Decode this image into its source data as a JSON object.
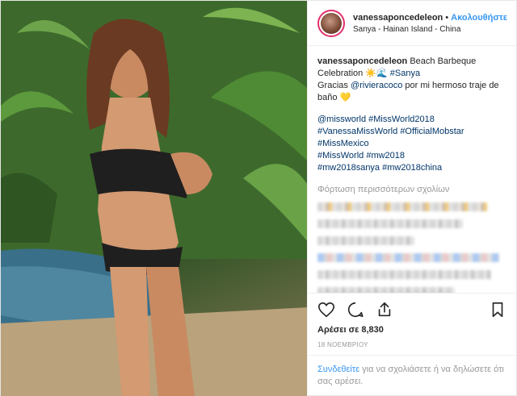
{
  "header": {
    "username": "vanessaponcedeleon",
    "separator": "•",
    "follow_label": "Ακολουθήστε",
    "location": "Sanya - Hainan Island - China"
  },
  "caption": {
    "username": "vanessaponcedeleon",
    "text": "Beach Barbeque Celebration ☀️🌊",
    "hashtag_sanya": "#Sanya",
    "line2_start": "Gracias",
    "mention": "@rivieracoco",
    "line2_end": "por mi hermoso traje de baño 💛"
  },
  "hashtags": {
    "line1": [
      "@missworld",
      "#MissWorld2018"
    ],
    "line2": [
      "#VanessaMissWorld",
      "#OfficialMobstar"
    ],
    "line3": [
      "#MissMexico"
    ],
    "line4": [
      "#MissWorld",
      "#mw2018"
    ],
    "line5": [
      "#mw2018sanya",
      "#mw2018china"
    ]
  },
  "load_more": "Φόρτωση περισσότερων σχολίων",
  "likes": "Αρέσει σε 8,830",
  "date": "18 ΝΟΕΜΒΡΙΟΥ",
  "login": {
    "link": "Συνδεθείτε",
    "text": "για να σχολιάσετε ή να δηλώσετε ότι σας αρέσει."
  },
  "icons": [
    "heart-icon",
    "comment-icon",
    "share-icon",
    "bookmark-icon"
  ],
  "colors": {
    "link": "#3897f0",
    "hashtag": "#003569",
    "muted": "#999999",
    "text": "#262626"
  }
}
